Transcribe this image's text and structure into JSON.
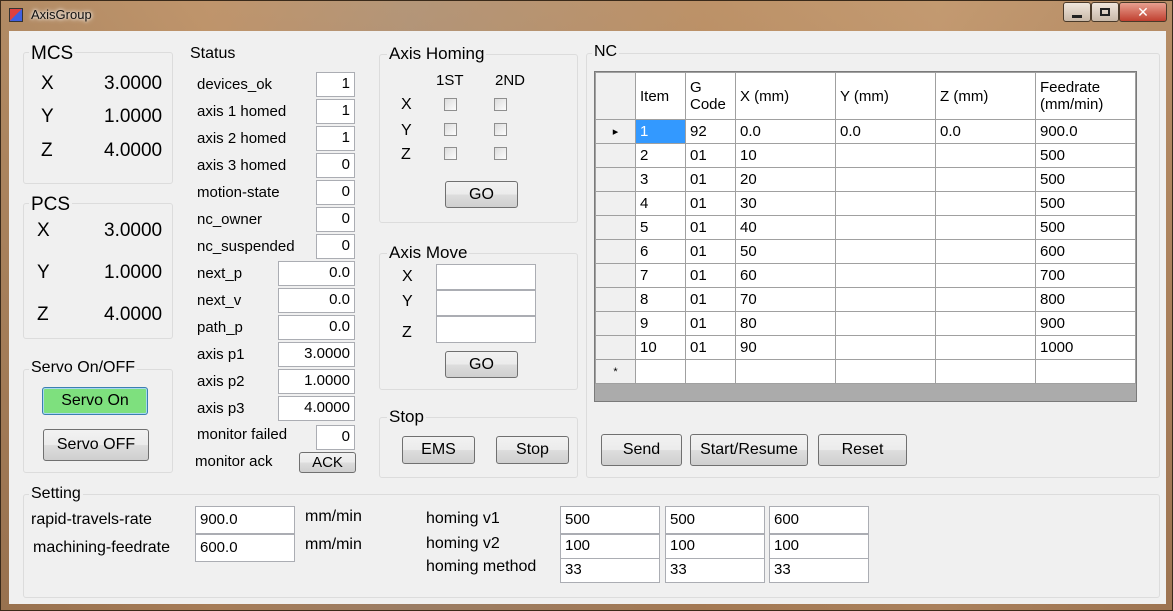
{
  "window": {
    "title": "AxisGroup",
    "close_icon": "close-icon",
    "maximize_icon": "maximize-icon",
    "minimize_icon": "minimize-icon"
  },
  "mcs": {
    "title": "MCS",
    "x_label": "X",
    "x_value": "3.0000",
    "y_label": "Y",
    "y_value": "1.0000",
    "z_label": "Z",
    "z_value": "4.0000"
  },
  "pcs": {
    "title": "PCS",
    "x_label": "X",
    "x_value": "3.0000",
    "y_label": "Y",
    "y_value": "1.0000",
    "z_label": "Z",
    "z_value": "4.0000"
  },
  "servo": {
    "title": "Servo On/OFF",
    "on_label": "Servo On",
    "off_label": "Servo OFF",
    "on_color": "#7ee07e"
  },
  "status": {
    "title": "Status",
    "devices_ok": {
      "label": "devices_ok",
      "value": "1"
    },
    "axis1_homed": {
      "label": "axis 1 homed",
      "value": "1"
    },
    "axis2_homed": {
      "label": "axis 2 homed",
      "value": "1"
    },
    "axis3_homed": {
      "label": "axis 3 homed",
      "value": "0"
    },
    "motion_state": {
      "label": "motion-state",
      "value": "0"
    },
    "nc_owner": {
      "label": "nc_owner",
      "value": "0"
    },
    "nc_suspended": {
      "label": "nc_suspended",
      "value": "0"
    },
    "next_p": {
      "label": "next_p",
      "value": "0.0"
    },
    "next_v": {
      "label": "next_v",
      "value": "0.0"
    },
    "path_p": {
      "label": "path_p",
      "value": "0.0"
    },
    "axis_p1": {
      "label": "axis p1",
      "value": "3.0000"
    },
    "axis_p2": {
      "label": "axis p2",
      "value": "1.0000"
    },
    "axis_p3": {
      "label": "axis p3",
      "value": "4.0000"
    },
    "monitor_failed": {
      "label": "monitor failed",
      "value": "0"
    },
    "monitor_ack": {
      "label": "monitor ack",
      "button": "ACK"
    }
  },
  "homing": {
    "title": "Axis Homing",
    "col1": "1ST",
    "col2": "2ND",
    "x_label": "X",
    "y_label": "Y",
    "z_label": "Z",
    "go_label": "GO"
  },
  "axis_move": {
    "title": "Axis Move",
    "x_label": "X",
    "y_label": "Y",
    "z_label": "Z",
    "x_value": "",
    "y_value": "",
    "z_value": "",
    "go_label": "GO"
  },
  "stop": {
    "title": "Stop",
    "ems_label": "EMS",
    "stop_label": "Stop"
  },
  "nc": {
    "title": "NC",
    "columns": [
      "Item",
      "G Code",
      "X (mm)",
      "Y (mm)",
      "Z (mm)",
      "Feedrate (mm/min)"
    ],
    "column_header_lines": [
      [
        "Item"
      ],
      [
        "G",
        "Code"
      ],
      [
        "X (mm)"
      ],
      [
        "Y (mm)"
      ],
      [
        "Z (mm)"
      ],
      [
        "Feedrate",
        "(mm/min)"
      ]
    ],
    "rows": [
      [
        "1",
        "92",
        "0.0",
        "0.0",
        "0.0",
        "900.0"
      ],
      [
        "2",
        "01",
        "10",
        "",
        "",
        "500"
      ],
      [
        "3",
        "01",
        "20",
        "",
        "",
        "500"
      ],
      [
        "4",
        "01",
        "30",
        "",
        "",
        "500"
      ],
      [
        "5",
        "01",
        "40",
        "",
        "",
        "500"
      ],
      [
        "6",
        "01",
        "50",
        "",
        "",
        "600"
      ],
      [
        "7",
        "01",
        "60",
        "",
        "",
        "700"
      ],
      [
        "8",
        "01",
        "70",
        "",
        "",
        "800"
      ],
      [
        "9",
        "01",
        "80",
        "",
        "",
        "900"
      ],
      [
        "10",
        "01",
        "90",
        "",
        "",
        "1000"
      ]
    ],
    "current_row_marker": "▸",
    "new_row_marker": "*",
    "send_label": "Send",
    "start_label": "Start/Resume",
    "reset_label": "Reset"
  },
  "setting": {
    "title": "Setting",
    "rapid_label": "rapid-travels-rate",
    "rapid_value": "900.0",
    "rapid_unit": "mm/min",
    "machining_label": "machining-feedrate",
    "machining_value": "600.0",
    "machining_unit": "mm/min",
    "homing_v1_label": "homing v1",
    "homing_v1": [
      "500",
      "500",
      "600"
    ],
    "homing_v2_label": "homing v2",
    "homing_v2": [
      "100",
      "100",
      "100"
    ],
    "homing_method_label": "homing method",
    "homing_method": [
      "33",
      "33",
      "33"
    ]
  }
}
